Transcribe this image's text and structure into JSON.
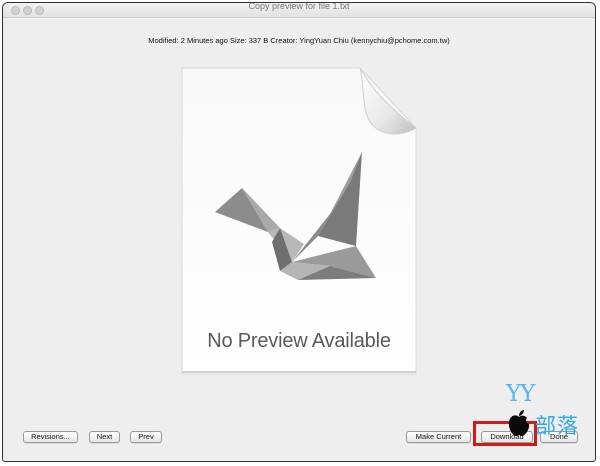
{
  "window": {
    "title": "Copy preview for file 1.txt"
  },
  "file_info": {
    "text": "Modified: 2 Minutes ago  Size: 337 B  Creator: YingYuan Chiu (kennychiu@pchome.com.tw)"
  },
  "preview": {
    "icon": "document-crane-icon",
    "message": "No Preview Available"
  },
  "buttons": {
    "revisions": "Revisions...",
    "next": "Next",
    "prev": "Prev",
    "make_current": "Make Current",
    "download": "Download",
    "done": "Done"
  },
  "watermark": {
    "yy": "YY",
    "blog": "部落"
  },
  "colors": {
    "highlight": "#d11a1a",
    "watermark": "#2ea8ea"
  }
}
